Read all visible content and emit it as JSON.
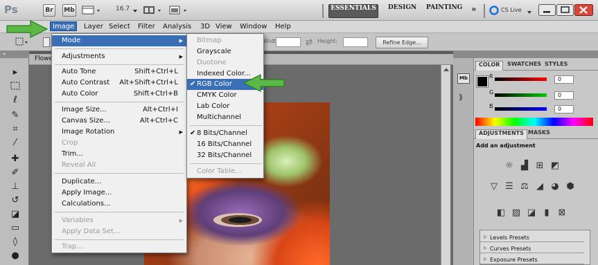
{
  "app_bar": {
    "logo": "Ps",
    "bridge": "Br",
    "minibridge": "Mb",
    "zoom": "16.7",
    "workspaces": [
      "ESSENTIALS",
      "DESIGN",
      "PAINTING"
    ],
    "more": "»",
    "cslive": "CS Live"
  },
  "menubar": {
    "items": [
      "Image",
      "Layer",
      "Select",
      "Filter",
      "Analysis",
      "3D",
      "View",
      "Window",
      "Help"
    ]
  },
  "options_bar": {
    "width_label": "Width:",
    "height_label": "Height:",
    "refine_edge": "Refine Edge..."
  },
  "document": {
    "tab_title": "Flowe"
  },
  "image_menu": {
    "items": [
      {
        "label": "Mode",
        "shortcut": "",
        "submenu": true,
        "highlighted": true
      },
      {
        "label": "Adjustments",
        "shortcut": "",
        "submenu": true
      },
      {
        "label": "Auto Tone",
        "shortcut": "Shift+Ctrl+L"
      },
      {
        "label": "Auto Contrast",
        "shortcut": "Alt+Shift+Ctrl+L"
      },
      {
        "label": "Auto Color",
        "shortcut": "Shift+Ctrl+B"
      },
      {
        "label": "Image Size...",
        "shortcut": "Alt+Ctrl+I"
      },
      {
        "label": "Canvas Size...",
        "shortcut": "Alt+Ctrl+C"
      },
      {
        "label": "Image Rotation",
        "shortcut": "",
        "submenu": true
      },
      {
        "label": "Crop",
        "shortcut": "",
        "disabled": true
      },
      {
        "label": "Trim...",
        "shortcut": ""
      },
      {
        "label": "Reveal All",
        "shortcut": "",
        "disabled": true
      },
      {
        "label": "Duplicate...",
        "shortcut": ""
      },
      {
        "label": "Apply Image...",
        "shortcut": ""
      },
      {
        "label": "Calculations...",
        "shortcut": ""
      },
      {
        "label": "Variables",
        "shortcut": "",
        "submenu": true,
        "disabled": true
      },
      {
        "label": "Apply Data Set...",
        "shortcut": "",
        "disabled": true
      },
      {
        "label": "Trap...",
        "shortcut": "",
        "disabled": true
      }
    ]
  },
  "mode_submenu": {
    "items": [
      {
        "label": "Bitmap",
        "disabled": true
      },
      {
        "label": "Grayscale"
      },
      {
        "label": "Duotone",
        "disabled": true
      },
      {
        "label": "Indexed Color..."
      },
      {
        "label": "RGB Color",
        "checked": true,
        "highlighted": true
      },
      {
        "label": "CMYK Color"
      },
      {
        "label": "Lab Color"
      },
      {
        "label": "Multichannel"
      },
      {
        "label": "8 Bits/Channel",
        "checked": true
      },
      {
        "label": "16 Bits/Channel"
      },
      {
        "label": "32 Bits/Channel"
      },
      {
        "label": "Color Table...",
        "disabled": true
      }
    ]
  },
  "color_panel": {
    "tabs": [
      "COLOR",
      "SWATCHES",
      "STYLES"
    ],
    "channels": [
      {
        "label": "R",
        "value": "0",
        "color": "#cc0000"
      },
      {
        "label": "G",
        "value": "0",
        "color": "#00aa00"
      },
      {
        "label": "B",
        "value": "0",
        "color": "#0000cc"
      }
    ]
  },
  "adjustments_panel": {
    "tabs": [
      "ADJUSTMENTS",
      "MASKS"
    ],
    "heading": "Add an adjustment",
    "presets": [
      "Levels Presets",
      "Curves Presets",
      "Exposure Presets"
    ]
  },
  "colors": {
    "menu_highlight": "#3a6fb8",
    "arrow_green": "#5cb844"
  }
}
